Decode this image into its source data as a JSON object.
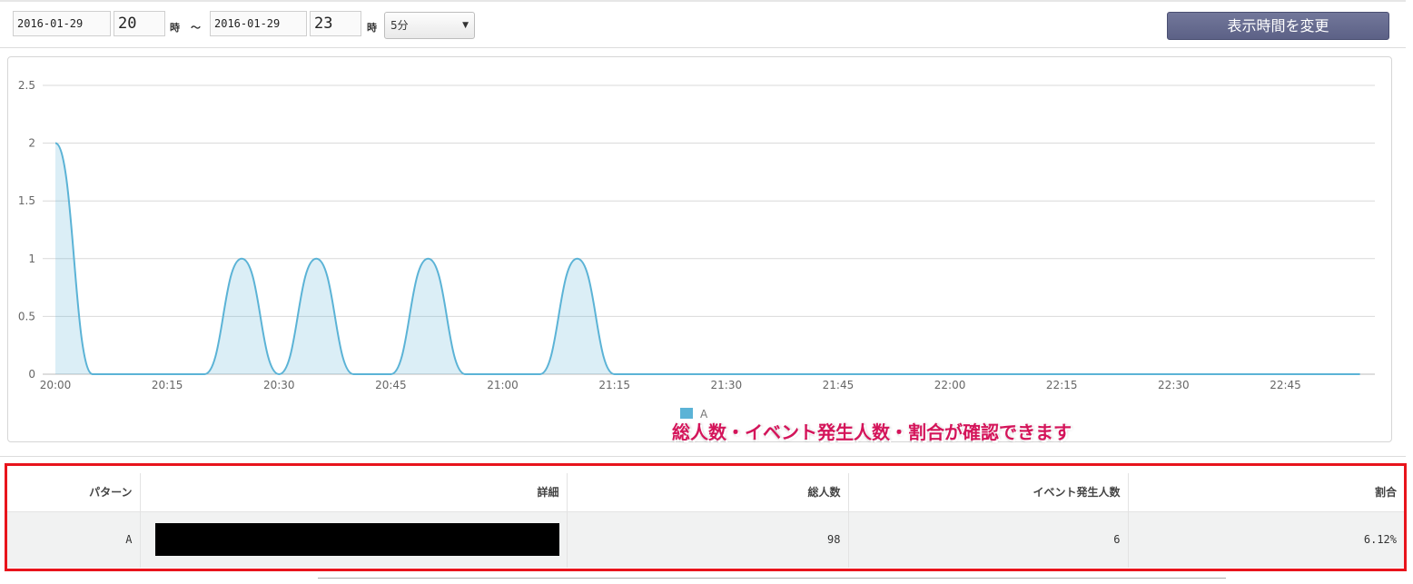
{
  "filters": {
    "start_date": "2016-01-29",
    "start_hour": "20",
    "hour_label_1": "時",
    "range_sep": "～",
    "end_date": "2016-01-29",
    "end_hour": "23",
    "hour_label_2": "時",
    "interval": "5分",
    "interval_caret": "▼",
    "apply_label": "表示時間を変更"
  },
  "chart_data": {
    "type": "area",
    "x": [
      "20:00",
      "20:05",
      "20:10",
      "20:15",
      "20:20",
      "20:25",
      "20:30",
      "20:35",
      "20:40",
      "20:45",
      "20:50",
      "20:55",
      "21:00",
      "21:05",
      "21:10",
      "21:15",
      "21:20",
      "21:25",
      "21:30",
      "21:35",
      "21:40",
      "21:45",
      "21:50",
      "21:55",
      "22:00",
      "22:05",
      "22:10",
      "22:15",
      "22:20",
      "22:25",
      "22:30",
      "22:35",
      "22:40",
      "22:45",
      "22:50",
      "22:55"
    ],
    "series": [
      {
        "name": "A",
        "values": [
          2,
          0,
          0,
          0,
          0,
          1,
          0,
          1,
          0,
          0,
          1,
          0,
          0,
          0,
          1,
          0,
          0,
          0,
          0,
          0,
          0,
          0,
          0,
          0,
          0,
          0,
          0,
          0,
          0,
          0,
          0,
          0,
          0,
          0,
          0,
          0
        ],
        "color": "#5bb3d6"
      }
    ],
    "xticks": [
      "20:00",
      "20:15",
      "20:30",
      "20:45",
      "21:00",
      "21:15",
      "21:30",
      "21:45",
      "22:00",
      "22:15",
      "22:30",
      "22:45"
    ],
    "yticks": [
      "0",
      "0.5",
      "1",
      "1.5",
      "2",
      "2.5"
    ],
    "ylim": [
      0,
      2.5
    ],
    "grid": true,
    "legend": "bottom-center",
    "legend_label": "A"
  },
  "annotation": "総人数・イベント発生人数・割合が確認できます",
  "table": {
    "headers": [
      "パターン",
      "詳細",
      "総人数",
      "イベント発生人数",
      "割合"
    ],
    "rows": [
      {
        "pattern": "A",
        "total": "98",
        "events": "6",
        "ratio": "6.12%"
      }
    ]
  }
}
